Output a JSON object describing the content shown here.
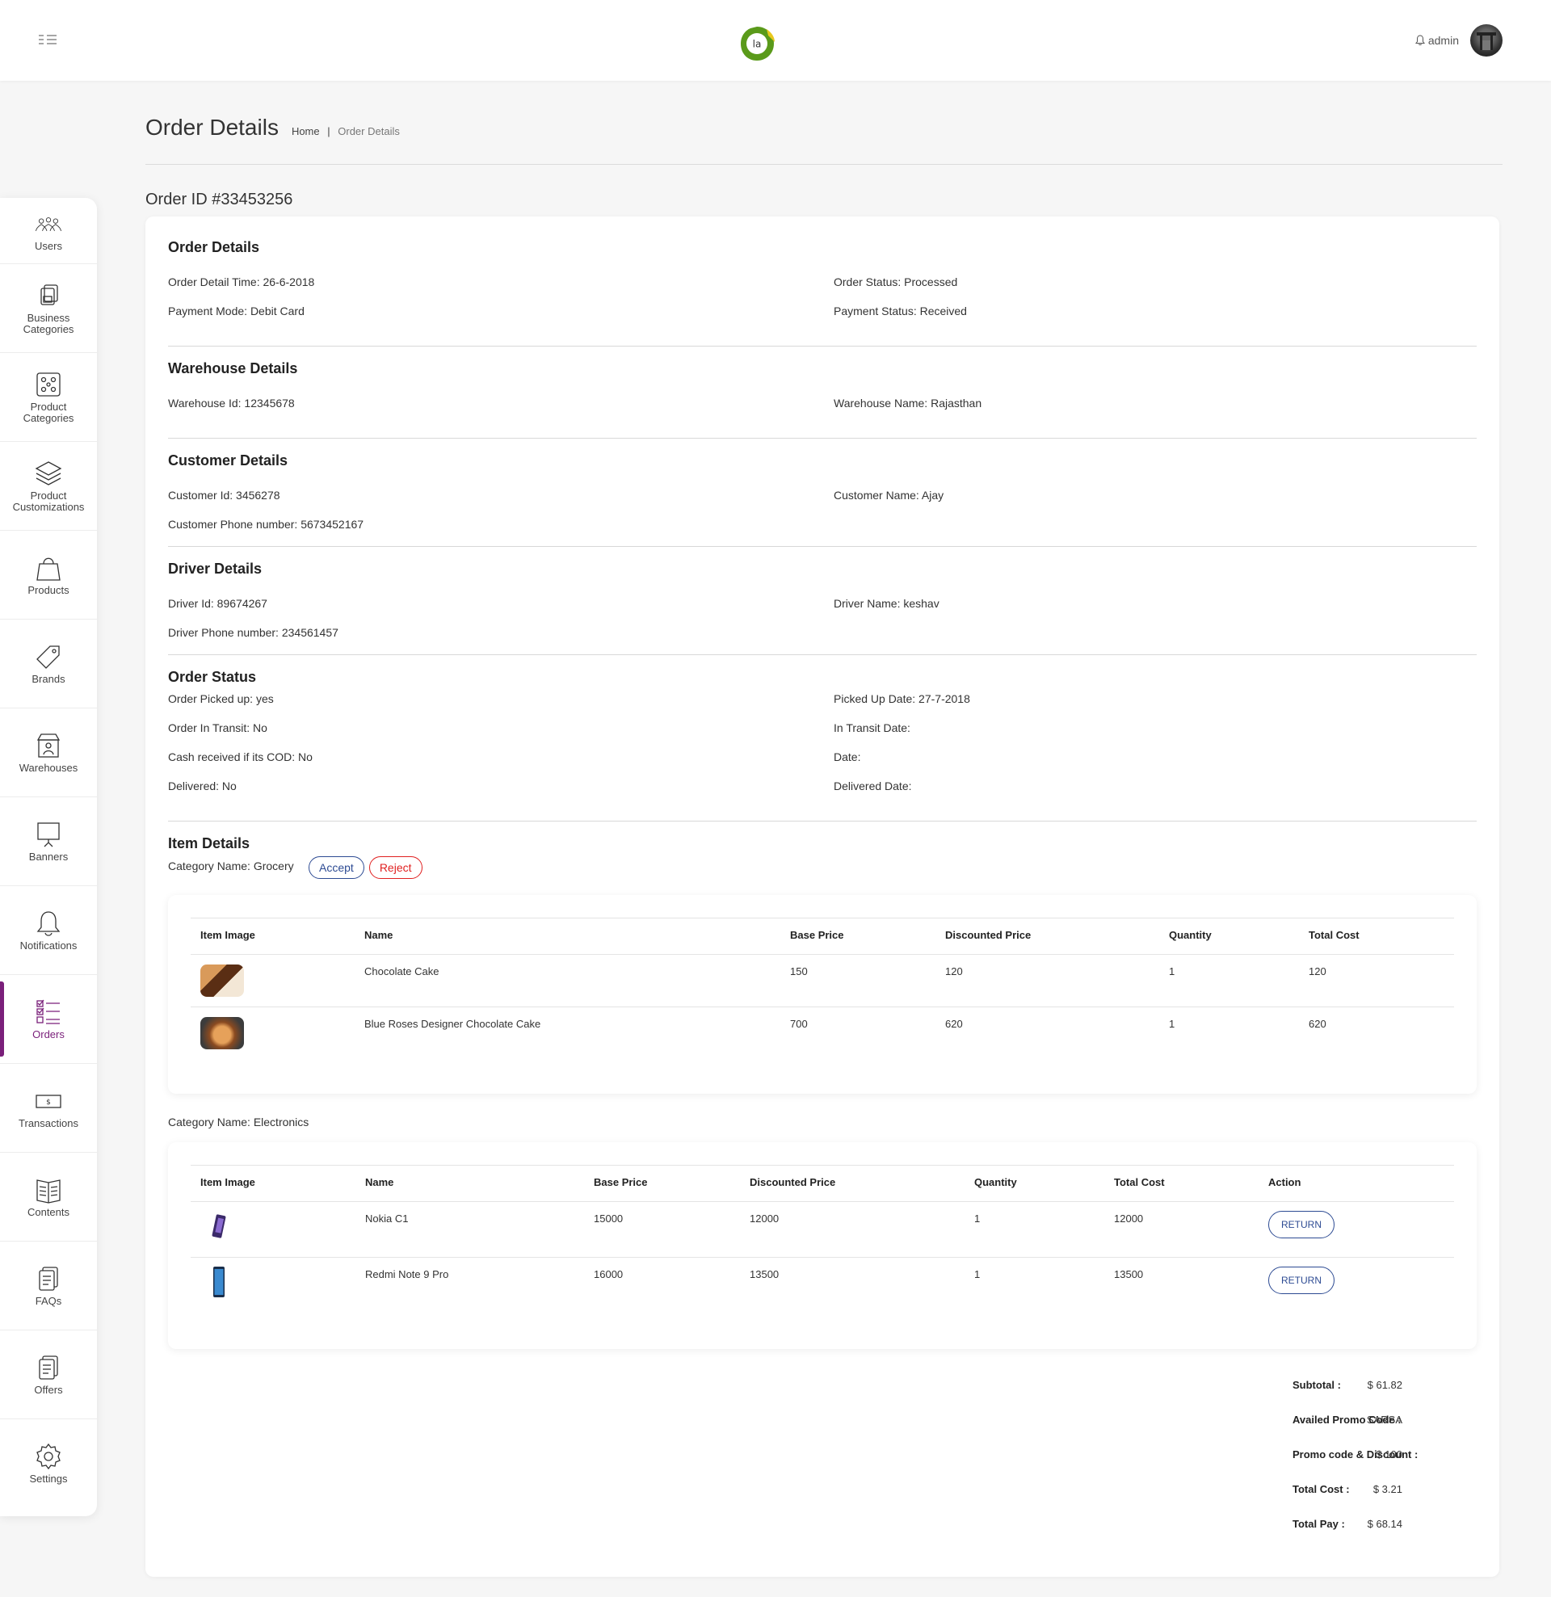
{
  "header": {
    "user": "admin"
  },
  "sidebar": [
    {
      "label": "Users",
      "icon": "users-icon"
    },
    {
      "label": "Business Categories",
      "icon": "business-categories-icon"
    },
    {
      "label": "Product Categories",
      "icon": "product-categories-icon"
    },
    {
      "label": "Product Customizations",
      "icon": "layers-icon"
    },
    {
      "label": "Products",
      "icon": "shopping-bag-icon"
    },
    {
      "label": "Brands",
      "icon": "tag-icon"
    },
    {
      "label": "Warehouses",
      "icon": "warehouse-icon"
    },
    {
      "label": "Banners",
      "icon": "banner-board-icon"
    },
    {
      "label": "Notifications",
      "icon": "bell-icon"
    },
    {
      "label": "Orders",
      "icon": "checklist-icon",
      "active": true
    },
    {
      "label": "Transactions",
      "icon": "cash-icon"
    },
    {
      "label": "Contents",
      "icon": "book-icon"
    },
    {
      "label": "FAQs",
      "icon": "faq-icon"
    },
    {
      "label": "Offers",
      "icon": "offers-icon"
    },
    {
      "label": "Settings",
      "icon": "gear-icon"
    }
  ],
  "page": {
    "title": "Order Details",
    "breadcrumb_home": "Home",
    "breadcrumb_sep": "|",
    "breadcrumb_current": "Order Details",
    "order_id": "Order ID #33453256"
  },
  "order_details": {
    "heading": "Order Details",
    "detail_time": "Order Detail Time: 26-6-2018",
    "status": "Order Status: Processed",
    "payment_mode": "Payment Mode: Debit Card",
    "payment_status": "Payment Status: Received"
  },
  "warehouse": {
    "heading": "Warehouse Details",
    "id": "Warehouse Id: 12345678",
    "name": "Warehouse Name: Rajasthan"
  },
  "customer": {
    "heading": "Customer Details",
    "id": "Customer Id: 3456278",
    "name": "Customer Name: Ajay",
    "phone": "Customer Phone number: 5673452167"
  },
  "driver": {
    "heading": "Driver Details",
    "id": "Driver Id: 89674267",
    "name": "Driver Name: keshav",
    "phone": "Driver Phone number: 234561457"
  },
  "order_status": {
    "heading": "Order Status",
    "picked_up": "Order Picked up: yes",
    "picked_up_date": "Picked Up Date: 27-7-2018",
    "in_transit": "Order In Transit: No",
    "in_transit_date": "In Transit Date:",
    "cash_received": "Cash received if its COD: No",
    "date": "Date:",
    "delivered": "Delivered: No",
    "delivered_date": "Delivered Date:"
  },
  "items": {
    "heading": "Item Details",
    "accept_label": "Accept",
    "reject_label": "Reject",
    "grocery": {
      "category": "Category Name: Grocery",
      "columns": [
        "Item Image",
        "Name",
        "Base Price",
        "Discounted Price",
        "Quantity",
        "Total Cost"
      ],
      "rows": [
        {
          "name": "Chocolate Cake",
          "base": "150",
          "disc": "120",
          "qty": "1",
          "total": "120"
        },
        {
          "name": "Blue Roses Designer Chocolate Cake",
          "base": "700",
          "disc": "620",
          "qty": "1",
          "total": "620"
        }
      ]
    },
    "electronics": {
      "category": "Category Name: Electronics",
      "columns": [
        "Item Image",
        "Name",
        "Base Price",
        "Discounted Price",
        "Quantity",
        "Total Cost",
        "Action"
      ],
      "rows": [
        {
          "name": "Nokia C1",
          "base": "15000",
          "disc": "12000",
          "qty": "1",
          "total": "12000",
          "action": "RETURN"
        },
        {
          "name": "Redmi Note 9 Pro",
          "base": "16000",
          "disc": "13500",
          "qty": "1",
          "total": "13500",
          "action": "RETURN"
        }
      ]
    }
  },
  "summary": {
    "subtotal_label": "Subtotal :",
    "subtotal": "$ 61.82",
    "promo_label": "Availed Promo Code :",
    "promo": "SARSA",
    "discount_label": "Promo code & Discount :",
    "discount": "$ 100",
    "total_cost_label": "Total Cost :",
    "total_cost": "$ 3.21",
    "total_pay_label": "Total Pay :",
    "total_pay": "$ 68.14"
  },
  "colors": {
    "accent": "#7a1f7a",
    "button_blue": "#2d4b93",
    "reject_red": "#e02020",
    "logo_green": "#5a9a1a"
  }
}
